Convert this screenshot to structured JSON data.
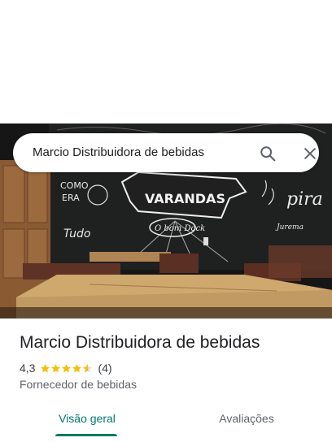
{
  "search": {
    "query": "Marcio Distribuidora de bebidas",
    "search_icon": "search-icon",
    "close_icon": "close-icon"
  },
  "place": {
    "title": "Marcio Distribuidora de bebidas",
    "rating": "4,3",
    "stars_filled_fraction": 0.86,
    "review_count": "(4)",
    "category": "Fornecedor de bebidas"
  },
  "tabs": [
    {
      "label": "Visão geral",
      "active": true
    },
    {
      "label": "Avaliações",
      "active": false
    }
  ],
  "hero_photo": {
    "chalkboard_words": [
      "VARANDAS",
      "O bom Dock",
      "COMO",
      "ERA",
      "Tudo",
      "pira"
    ]
  },
  "colors": {
    "accent": "#00796b",
    "star": "#fbbc04",
    "star_empty": "#dadce0",
    "text_primary": "#202124",
    "text_secondary": "#5f6368"
  }
}
